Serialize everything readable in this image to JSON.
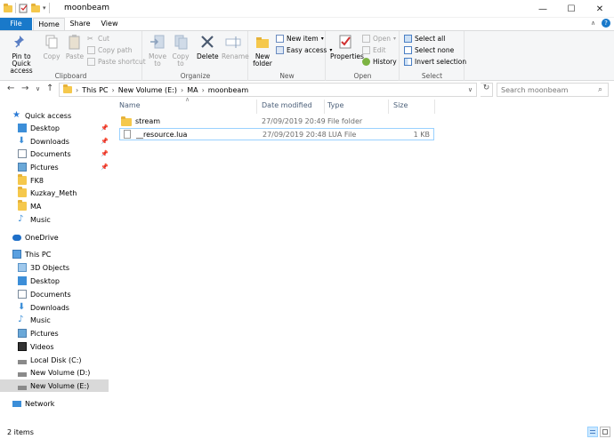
{
  "window": {
    "title": "moonbeam",
    "minimize": "—",
    "maximize": "☐",
    "close": "✕"
  },
  "ribbon_tabs": [
    "File",
    "Home",
    "Share",
    "View"
  ],
  "ribbon": {
    "clipboard": {
      "label": "Clipboard",
      "pin": "Pin to Quick access",
      "copy": "Copy",
      "paste": "Paste",
      "cut": "Cut",
      "copy_path": "Copy path",
      "paste_shortcut": "Paste shortcut"
    },
    "organize": {
      "label": "Organize",
      "move_to": "Move to",
      "copy_to": "Copy to",
      "delete": "Delete",
      "rename": "Rename"
    },
    "new": {
      "label": "New",
      "new_folder": "New folder",
      "new_item": "New item",
      "easy_access": "Easy access"
    },
    "open": {
      "label": "Open",
      "properties": "Properties",
      "open": "Open",
      "edit": "Edit",
      "history": "History"
    },
    "select": {
      "label": "Select",
      "select_all": "Select all",
      "select_none": "Select none",
      "invert": "Invert selection"
    }
  },
  "address": {
    "crumbs": [
      "This PC",
      "New Volume (E:)",
      "MA",
      "moonbeam"
    ],
    "search_placeholder": "Search moonbeam"
  },
  "nav": {
    "quick_access": "Quick access",
    "quick_items": [
      "Desktop",
      "Downloads",
      "Documents",
      "Pictures",
      "FK8",
      "Kuzkay_Meth",
      "MA",
      "Music"
    ],
    "onedrive": "OneDrive",
    "this_pc": "This PC",
    "pc_items": [
      "3D Objects",
      "Desktop",
      "Documents",
      "Downloads",
      "Music",
      "Pictures",
      "Videos",
      "Local Disk (C:)",
      "New Volume (D:)",
      "New Volume (E:)"
    ],
    "network": "Network"
  },
  "columns": {
    "name": "Name",
    "date": "Date modified",
    "type": "Type",
    "size": "Size"
  },
  "files": [
    {
      "name": "stream",
      "date": "27/09/2019 20:49",
      "type": "File folder",
      "size": ""
    },
    {
      "name": "__resource.lua",
      "date": "27/09/2019 20:48",
      "type": "LUA File",
      "size": "1 KB"
    }
  ],
  "status": {
    "count": "2 items"
  },
  "colors": {
    "accent": "#1979ca",
    "selection": "#cce8ff",
    "folder": "#f5c84c"
  }
}
